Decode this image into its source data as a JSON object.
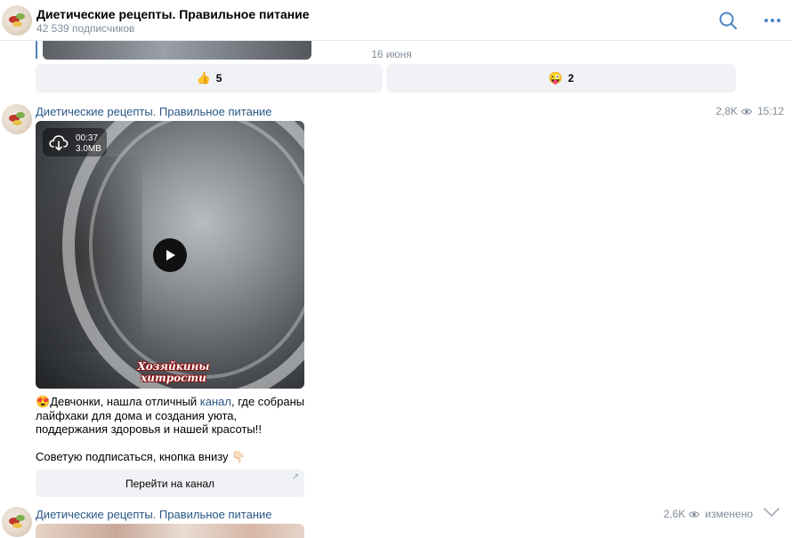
{
  "header": {
    "title": "Диетические рецепты. Правильное питание",
    "subscribers": "42 539 подписчиков"
  },
  "feed": {
    "date_separator": "16 июня",
    "reactions": [
      {
        "emoji": "👍",
        "count": "5"
      },
      {
        "emoji": "😜",
        "count": "2"
      }
    ]
  },
  "post": {
    "author": "Диетические рецепты. Правильное питание",
    "views": "2,8K",
    "time": "15:12",
    "video": {
      "duration": "00:37",
      "size": "3.0MB",
      "watermark_line1": "Хозяйкины",
      "watermark_line2": "хитрости"
    },
    "text": {
      "emoji_lead": "😍",
      "before_link": "Девчонки, нашла отличный ",
      "link": "канал",
      "after_link_l1": ", где собраны",
      "line2": "лайфхаки для дома и создания уюта,",
      "line3": "поддержания здоровья и нашей красоты!!",
      "line4": "Советую подписаться, кнопка внизу",
      "emoji_end": "👇🏻"
    },
    "button_label": "Перейти на канал",
    "button_arrow": "↗"
  },
  "next_post": {
    "author": "Диетические рецепты. Правильное питание",
    "views": "2,6K",
    "status": "изменено"
  },
  "colors": {
    "accent": "#2a5885",
    "icon": "#4a86c5",
    "muted": "#818c99",
    "surface": "#f0f2f5"
  },
  "icons": {
    "search": "search-icon",
    "more": "more-icon",
    "eye": "eye-icon",
    "download": "download-icon",
    "play": "play-icon",
    "chevron": "chevron-down-icon"
  }
}
